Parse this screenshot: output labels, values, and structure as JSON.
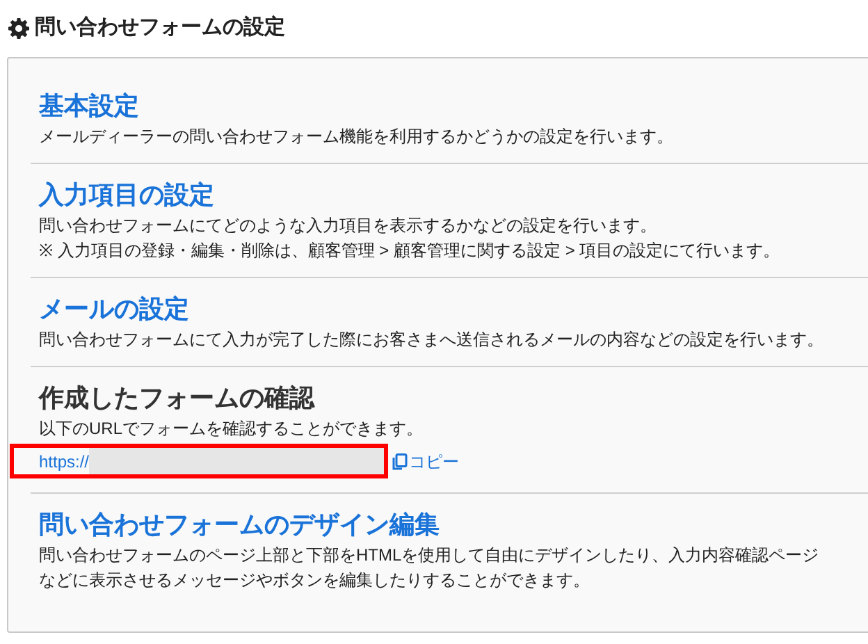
{
  "page_title": "問い合わせフォームの設定",
  "sections": [
    {
      "kind": "link",
      "heading": "基本設定",
      "lines": [
        "メールディーラーの問い合わせフォーム機能を利用するかどうかの設定を行います。"
      ]
    },
    {
      "kind": "link",
      "heading": "入力項目の設定",
      "lines": [
        "問い合わせフォームにてどのような入力項目を表示するかなどの設定を行います。",
        "※ 入力項目の登録・編集・削除は、顧客管理 > 顧客管理に関する設定 > 項目の設定にて行います。"
      ]
    },
    {
      "kind": "link",
      "heading": "メールの設定",
      "lines": [
        "問い合わせフォームにて入力が完了した際にお客さまへ送信されるメールの内容などの設定を行います。"
      ]
    },
    {
      "kind": "plain",
      "heading": "作成したフォームの確認",
      "lines": [
        "以下のURLでフォームを確認することができます。"
      ],
      "url": {
        "text": "https://",
        "redacted": true,
        "highlighted": true
      },
      "copy_label": "コピー"
    },
    {
      "kind": "link",
      "heading": "問い合わせフォームのデザイン編集",
      "lines": [
        "問い合わせフォームのページ上部と下部をHTMLを使用して自由にデザインしたり、入力内容確認ページ",
        "などに表示させるメッセージやボタンを編集したりすることができます。"
      ]
    }
  ]
}
